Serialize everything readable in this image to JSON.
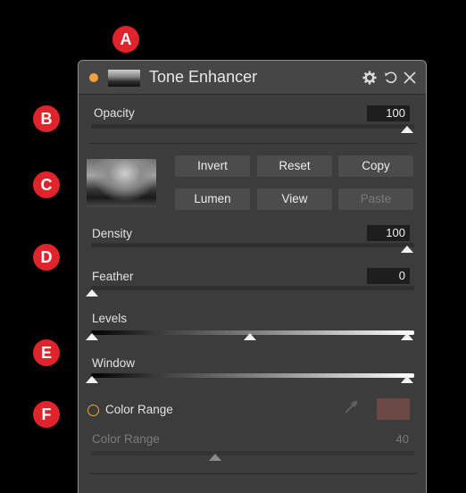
{
  "markers": [
    "A",
    "B",
    "C",
    "D",
    "E",
    "F"
  ],
  "panel": {
    "title": "Tone Enhancer",
    "title_icons": [
      "gear-icon",
      "undo-icon",
      "close-icon"
    ],
    "status_dot_color": "#f5a03a"
  },
  "opacity": {
    "label": "Opacity",
    "value": "100",
    "level": 1.0
  },
  "mask": {
    "buttons": {
      "invert": "Invert",
      "reset": "Reset",
      "copy": "Copy",
      "lumen": "Lumen",
      "view": "View",
      "paste": "Paste"
    },
    "paste_disabled": true
  },
  "density": {
    "label": "Density",
    "value": "100",
    "level": 1.0
  },
  "feather": {
    "label": "Feather",
    "value": "0",
    "level": 0.0
  },
  "levels": {
    "label": "Levels",
    "handles": [
      0.0,
      0.5,
      1.0
    ]
  },
  "window": {
    "label": "Window",
    "handles": [
      0.0,
      1.0
    ]
  },
  "color_range": {
    "toggle_label": "Color Range",
    "slider_label": "Color Range",
    "value": "40",
    "level": 0.38,
    "swatch_color": "#6b4844",
    "icon": "eyedropper-icon"
  }
}
